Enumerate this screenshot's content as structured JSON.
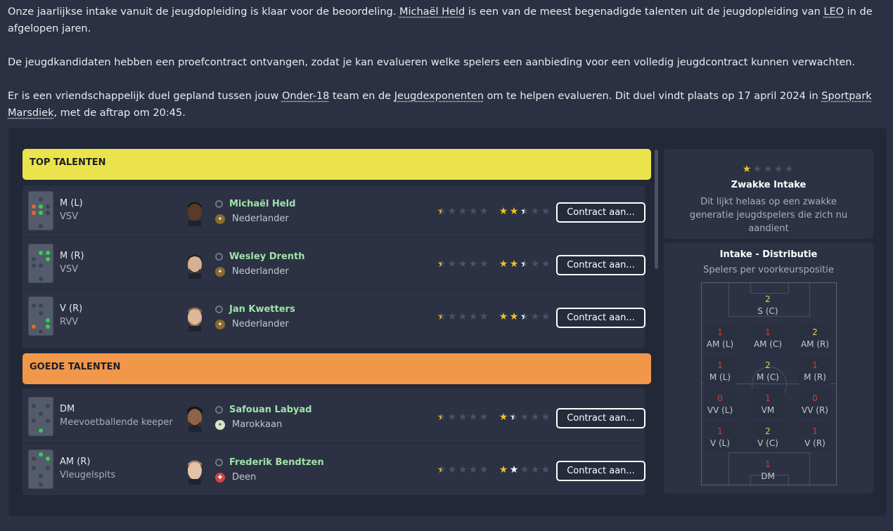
{
  "intro": {
    "p1_a": "Onze jaarlijkse intake vanuit de jeugdopleiding is klaar voor de beoordeling. ",
    "p1_link1": "Michaël Held",
    "p1_b": " is een van de meest begenadigde talenten uit de jeugdopleiding van ",
    "p1_link2": "LEO",
    "p1_c": " in de afgelopen jaren.",
    "p2": "De jeugdkandidaten hebben een proefcontract ontvangen, zodat je kan evalueren welke spelers een aanbieding voor een volledig jeugdcontract kunnen verwachten.",
    "p3_a": "Er is een vriendschappelijk duel gepland tussen jouw ",
    "p3_link1": "Onder-18",
    "p3_b": " team en de ",
    "p3_link2": "Jeugdexponenten",
    "p3_c": " om te helpen evalueren. Dit duel vindt plaats op 17 april 2024 in ",
    "p3_link3": "Sportpark Marsdiek",
    "p3_d": ", met de aftrap om 20:45."
  },
  "categories": {
    "top": "TOP TALENTEN",
    "good": "GOEDE TALENTEN"
  },
  "players": [
    {
      "position": "M (L)",
      "role": "VSV",
      "name": "Michaël Held",
      "nationality": "Nederlander",
      "current_ability": 0.5,
      "potential_ability": 2.5,
      "button": "Contract aan..."
    },
    {
      "position": "M (R)",
      "role": "VSV",
      "name": "Wesley Drenth",
      "nationality": "Nederlander",
      "current_ability": 0.5,
      "potential_ability": 2.5,
      "button": "Contract aan..."
    },
    {
      "position": "V (R)",
      "role": "RVV",
      "name": "Jan Kwetters",
      "nationality": "Nederlander",
      "current_ability": 0.5,
      "potential_ability": 2.5,
      "button": "Contract aan..."
    },
    {
      "position": "DM",
      "role": "Meevoetballende keeper",
      "name": "Safouan Labyad",
      "nationality": "Marokkaan",
      "current_ability": 0.5,
      "potential_ability": 1.5,
      "button": "Contract aan..."
    },
    {
      "position": "AM (R)",
      "role": "Vleugelspits",
      "name": "Frederik Bendtzen",
      "nationality": "Deen",
      "current_ability": 0.5,
      "potential_ability": 2.0,
      "button": "Contract aan..."
    }
  ],
  "intake": {
    "stars": 1,
    "title": "Zwakke Intake",
    "description": "Dit lijkt helaas op een zwakke generatie jeugdspelers die zich nu aandient"
  },
  "distribution": {
    "title": "Intake - Distributie",
    "subtitle": "Spelers per voorkeurspositie",
    "positions": {
      "s_c": {
        "count": "2",
        "label": "S (C)"
      },
      "am_l": {
        "count": "1",
        "label": "AM (L)"
      },
      "am_c": {
        "count": "1",
        "label": "AM (C)"
      },
      "am_r": {
        "count": "2",
        "label": "AM (R)"
      },
      "m_l": {
        "count": "1",
        "label": "M (L)"
      },
      "m_c": {
        "count": "2",
        "label": "M (C)"
      },
      "m_r": {
        "count": "1",
        "label": "M (R)"
      },
      "vv_l": {
        "count": "0",
        "label": "VV (L)"
      },
      "vm": {
        "count": "1",
        "label": "VM"
      },
      "vv_r": {
        "count": "0",
        "label": "VV (R)"
      },
      "v_l": {
        "count": "1",
        "label": "V (L)"
      },
      "v_c": {
        "count": "2",
        "label": "V (C)"
      },
      "v_r": {
        "count": "1",
        "label": "V (R)"
      },
      "dm": {
        "count": "1",
        "label": "DM"
      }
    }
  },
  "colors": {
    "top_talent_header": "#ebe34b",
    "good_talent_header": "#f0974a",
    "player_name": "#9fe3a8",
    "star_gold": "#f0c323",
    "count_red": "#d63b3b",
    "count_yellow": "#f0c94a"
  }
}
